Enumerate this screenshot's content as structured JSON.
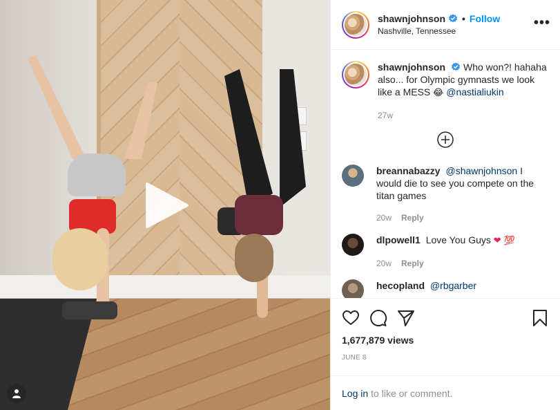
{
  "post": {
    "author": {
      "username": "shawnjohnson",
      "location": "Nashville, Tennessee",
      "follow_label": "Follow",
      "separator": "•",
      "more_label": "•••"
    },
    "caption": {
      "username": "shawnjohnson",
      "text_before": "Who won?! hahaha also... for Olympic gymnasts we look like a MESS",
      "emoji": "😂",
      "mention": "@nastialiukin",
      "age": "27w"
    },
    "comments": [
      {
        "username": "breannabazzy",
        "mention": "@shawnjohnson",
        "text": "I would die to see you compete on the titan games",
        "age": "20w",
        "reply_label": "Reply",
        "avatar_color": "#6f8a9e"
      },
      {
        "username": "dlpowell1",
        "text": "Love You Guys",
        "emoji": "❤ 💯",
        "age": "20w",
        "reply_label": "Reply",
        "avatar_color": "#3a2a24"
      },
      {
        "username": "hecopland",
        "mention": "@rbgarber",
        "avatar_color": "#8a7a6a"
      }
    ],
    "views": "1,677,879 views",
    "date": "JUNE 8",
    "login": {
      "link": "Log in",
      "text": "to like or comment."
    }
  },
  "icons": {
    "verified": "verified-badge-icon",
    "more": "more-options-icon",
    "load_more": "plus-circle-icon",
    "like": "heart-icon",
    "comment": "comment-icon",
    "share": "share-icon",
    "save": "bookmark-icon",
    "play": "play-icon",
    "user_tag": "user-tag-icon"
  },
  "colors": {
    "link_blue": "#0095f6",
    "mention_blue": "#00376b",
    "meta_gray": "#8e8e8e",
    "text": "#262626"
  }
}
